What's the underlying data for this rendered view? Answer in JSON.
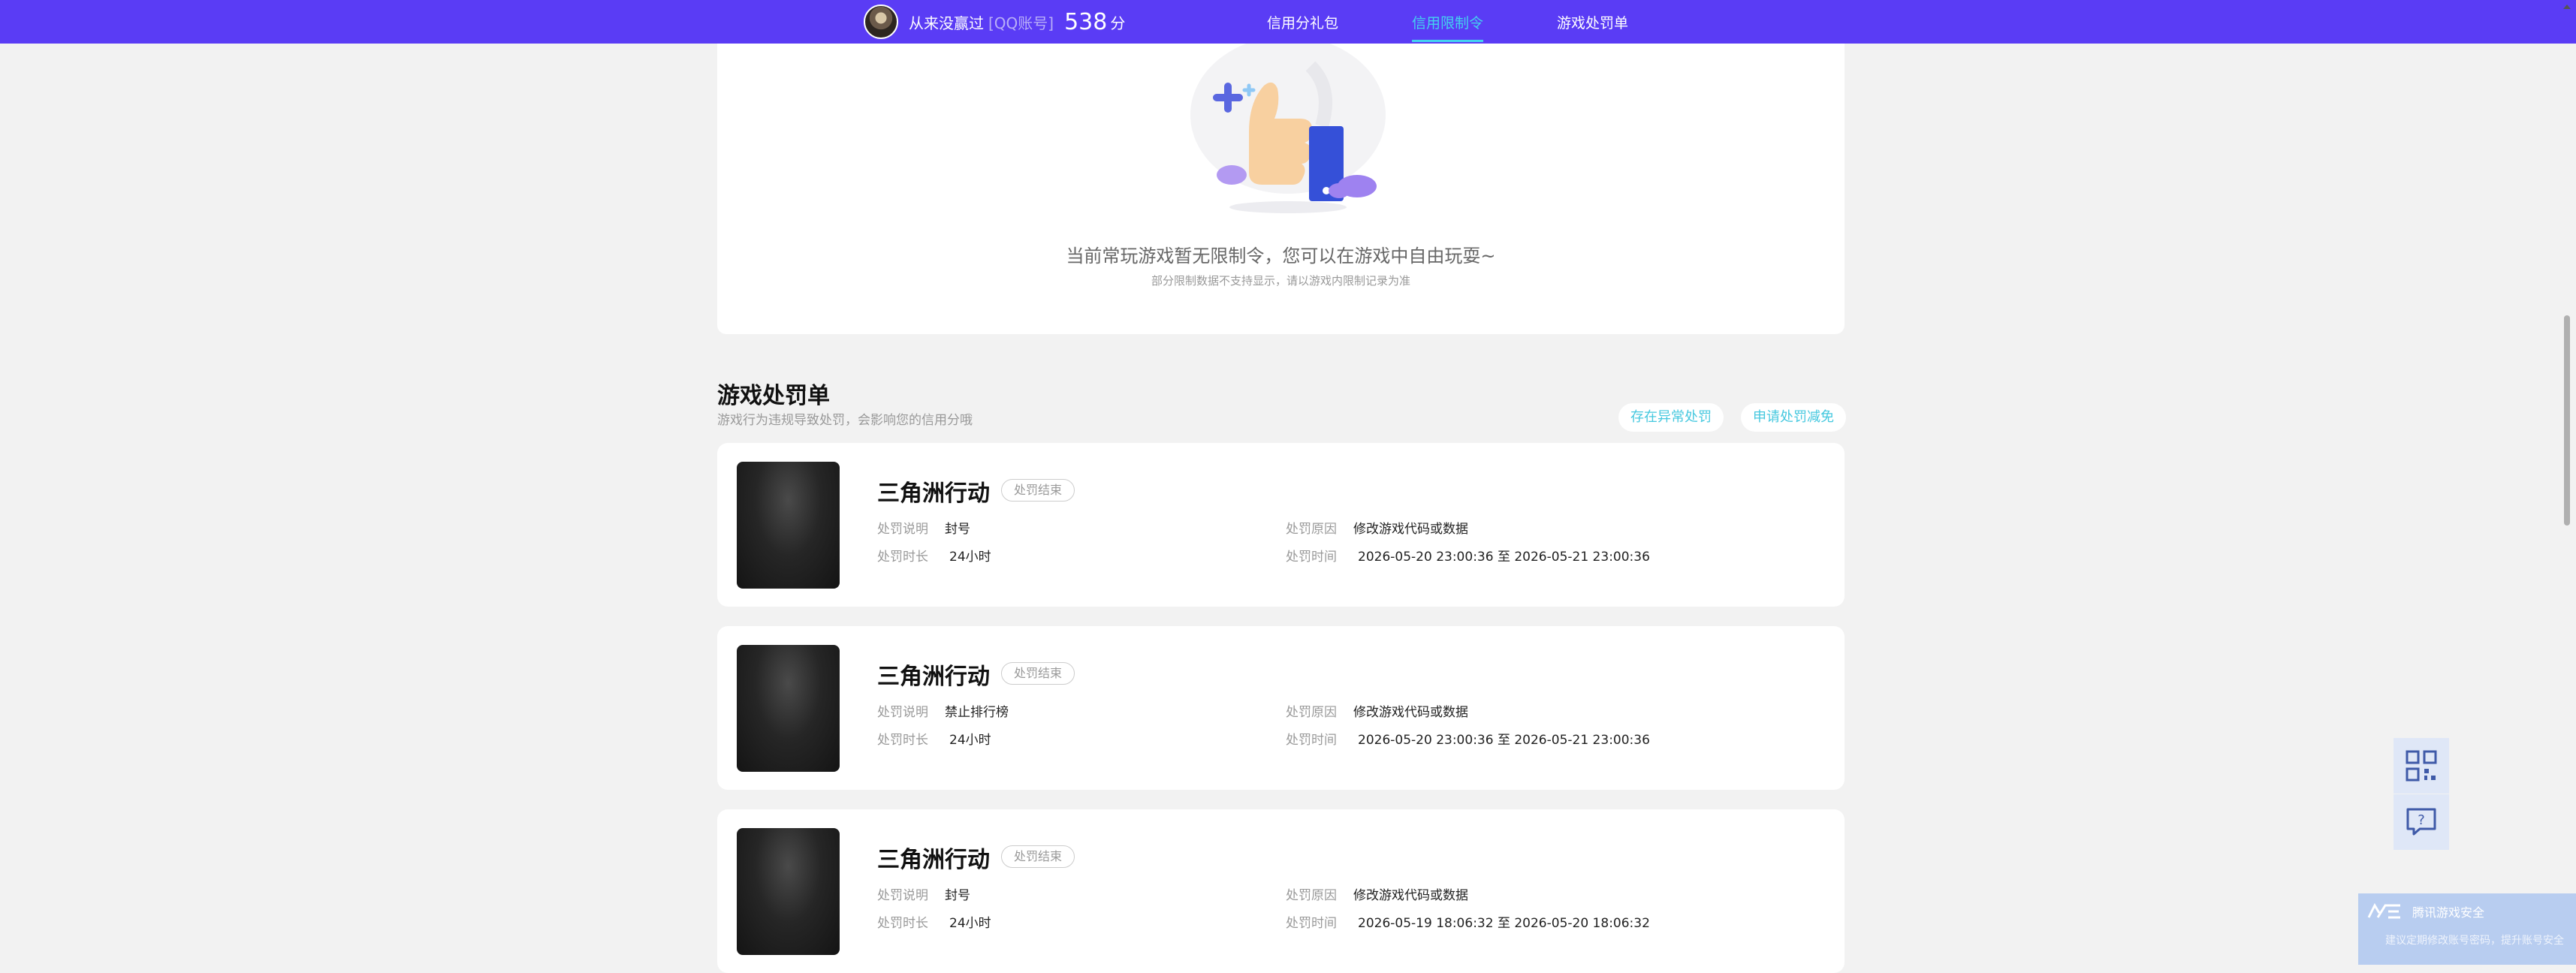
{
  "header": {
    "user_name": "从来没赢过",
    "account_type": "[QQ账号]",
    "score": "538",
    "score_unit": "分",
    "nav": [
      {
        "label": "信用分礼包"
      },
      {
        "label": "信用限制令"
      },
      {
        "label": "游戏处罚单"
      }
    ]
  },
  "restriction": {
    "empty_message": "当前常玩游戏暂无限制令，您可以在游戏中自由玩耍~",
    "empty_note": "部分限制数据不支持显示，请以游戏内限制记录为准"
  },
  "penalties": {
    "title": "游戏处罚单",
    "description": "游戏行为违规导致处罚，会影响您的信用分哦",
    "abnormal_button": "存在异常处罚",
    "appeal_button": "申请处罚减免",
    "labels": {
      "description": "处罚说明",
      "duration": "处罚时长",
      "reason": "处罚原因",
      "time": "处罚时间"
    },
    "items": [
      {
        "game": "三角洲行动",
        "status": "处罚结束",
        "description": "封号",
        "duration": "24小时",
        "reason": "修改游戏代码或数据",
        "time": "2026-05-20 23:00:36 至 2026-05-21 23:00:36"
      },
      {
        "game": "三角洲行动",
        "status": "处罚结束",
        "description": "禁止排行榜",
        "duration": "24小时",
        "reason": "修改游戏代码或数据",
        "time": "2026-05-20 23:00:36 至 2026-05-21 23:00:36"
      },
      {
        "game": "三角洲行动",
        "status": "处罚结束",
        "description": "封号",
        "duration": "24小时",
        "reason": "修改游戏代码或数据",
        "time": "2026-05-19 18:06:32 至 2026-05-20 18:06:32"
      }
    ]
  },
  "side_tools": [
    {
      "icon": "qr-code-icon"
    },
    {
      "icon": "help-chat-icon"
    }
  ],
  "popup": {
    "title": "腾讯游戏安全",
    "text": "建议定期修改账号密码，提升账号安全"
  }
}
